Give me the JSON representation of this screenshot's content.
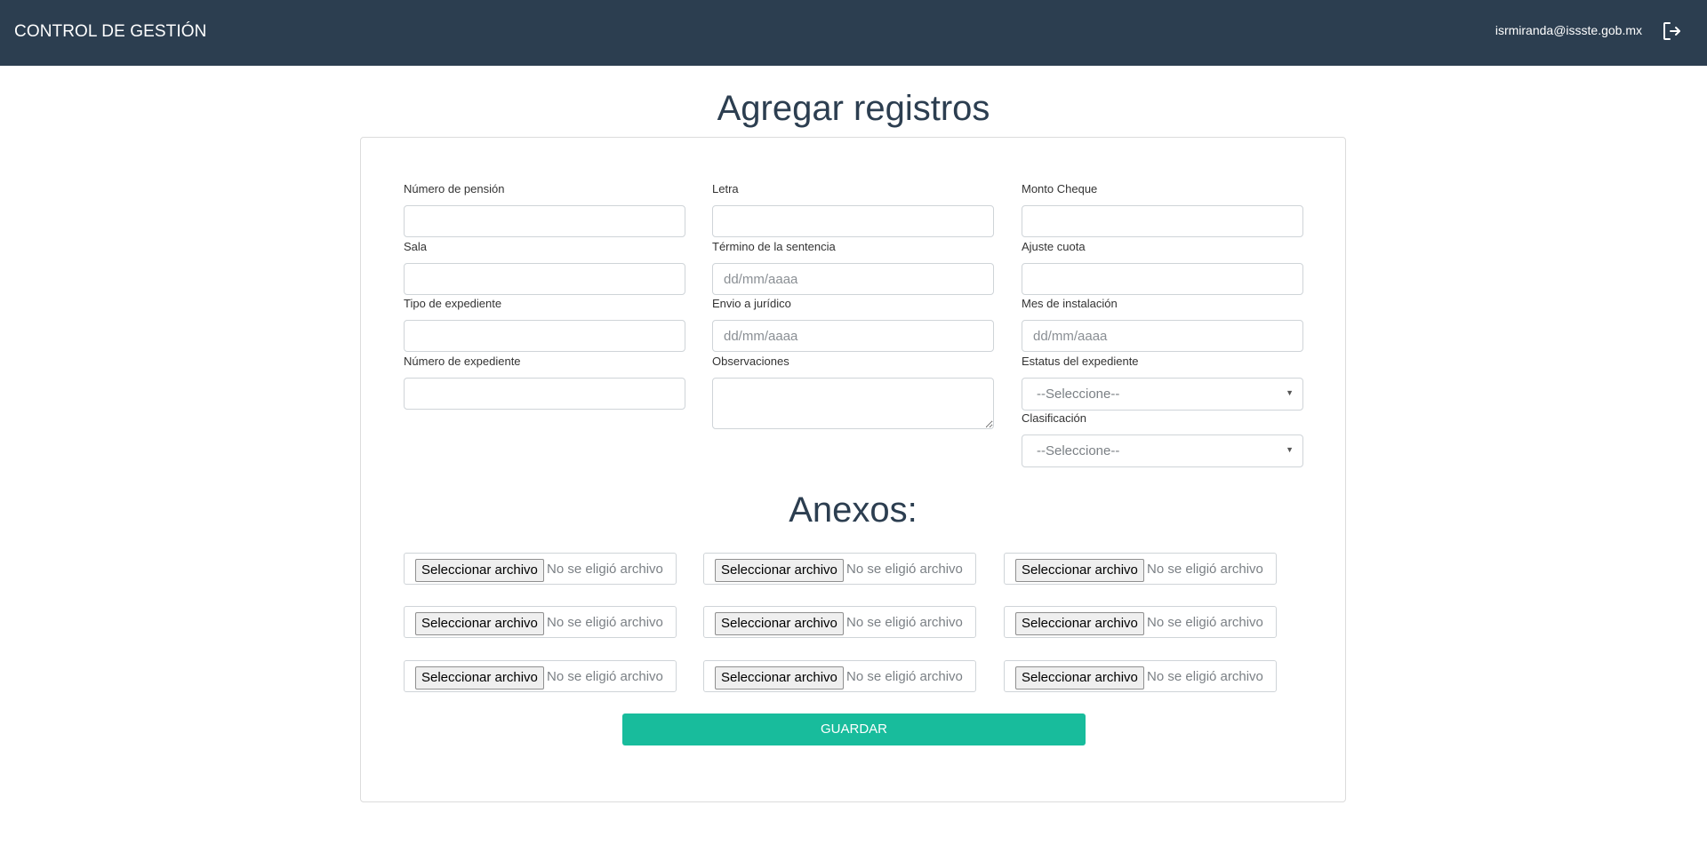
{
  "header": {
    "brand": "CONTROL DE GESTIÓN",
    "user_email": "isrmiranda@issste.gob.mx",
    "logout_icon": "logout-icon"
  },
  "page": {
    "title": "Agregar registros"
  },
  "form": {
    "col1": [
      {
        "label": "Número de pensión",
        "value": "",
        "placeholder": ""
      },
      {
        "label": "Sala",
        "value": "",
        "placeholder": ""
      },
      {
        "label": "Tipo de expediente",
        "value": "",
        "placeholder": ""
      },
      {
        "label": "Número de expediente",
        "value": "",
        "placeholder": ""
      }
    ],
    "col2": [
      {
        "label": "Letra",
        "value": "",
        "placeholder": ""
      },
      {
        "label": "Término de la sentencia",
        "value": "",
        "placeholder": "dd/mm/aaaa"
      },
      {
        "label": "Envio a jurídico",
        "value": "",
        "placeholder": "dd/mm/aaaa"
      },
      {
        "label": "Observaciones",
        "value": "",
        "placeholder": ""
      }
    ],
    "col3": [
      {
        "label": "Monto Cheque",
        "value": "",
        "placeholder": ""
      },
      {
        "label": "Ajuste cuota",
        "value": "",
        "placeholder": ""
      },
      {
        "label": "Mes de instalación",
        "value": "",
        "placeholder": "dd/mm/aaaa"
      },
      {
        "label": "Estatus del expediente",
        "selected": "--Seleccione--"
      },
      {
        "label": "Clasificación",
        "selected": "--Seleccione--"
      }
    ]
  },
  "anexos": {
    "title": "Anexos:",
    "button_label": "Seleccionar archivo",
    "status_text": "No se eligió archivo"
  },
  "actions": {
    "save_label": "GUARDAR"
  },
  "colors": {
    "navbar": "#2c3e50",
    "primary_text": "#2c3e50",
    "save_button": "#18bc9c"
  }
}
